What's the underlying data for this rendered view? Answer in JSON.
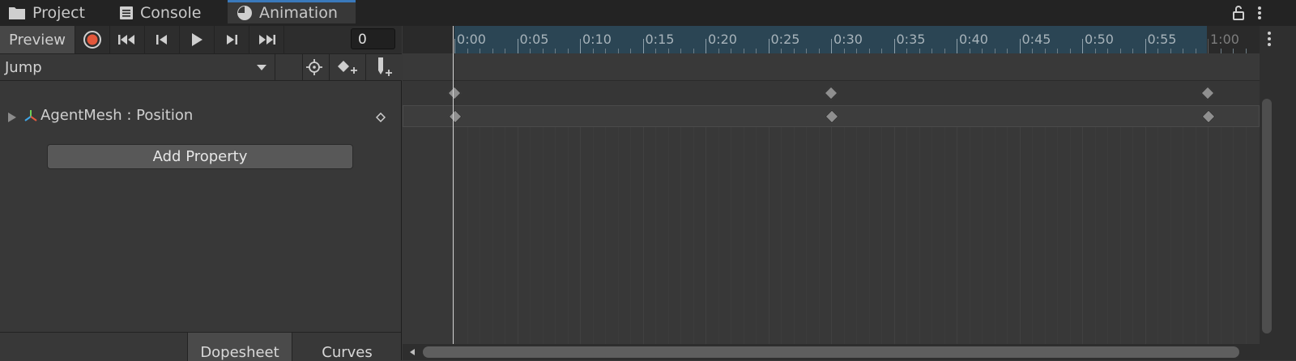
{
  "tabs": [
    {
      "label": "Project",
      "icon": "folder-icon"
    },
    {
      "label": "Console",
      "icon": "console-icon"
    },
    {
      "label": "Animation",
      "icon": "animation-clock-icon"
    }
  ],
  "toolbar": {
    "preview_label": "Preview",
    "frame_value": "0"
  },
  "clip": {
    "name": "Jump"
  },
  "properties": [
    {
      "label": "AgentMesh : Position"
    }
  ],
  "add_property_label": "Add Property",
  "bottom_tabs": [
    "Dopesheet",
    "Curves"
  ],
  "timeline": {
    "ticks": [
      "0:00",
      "0:05",
      "0:10",
      "0:15",
      "0:20",
      "0:25",
      "0:30",
      "0:35",
      "0:40",
      "0:45",
      "0:50",
      "0:55",
      "1:00"
    ],
    "keyframe_times": [
      "0:00",
      "0:30",
      "0:60"
    ]
  },
  "colors": {
    "accent_tab": "#3a79bb",
    "record": "#e2573b",
    "ruler_active": "#2b4554"
  }
}
